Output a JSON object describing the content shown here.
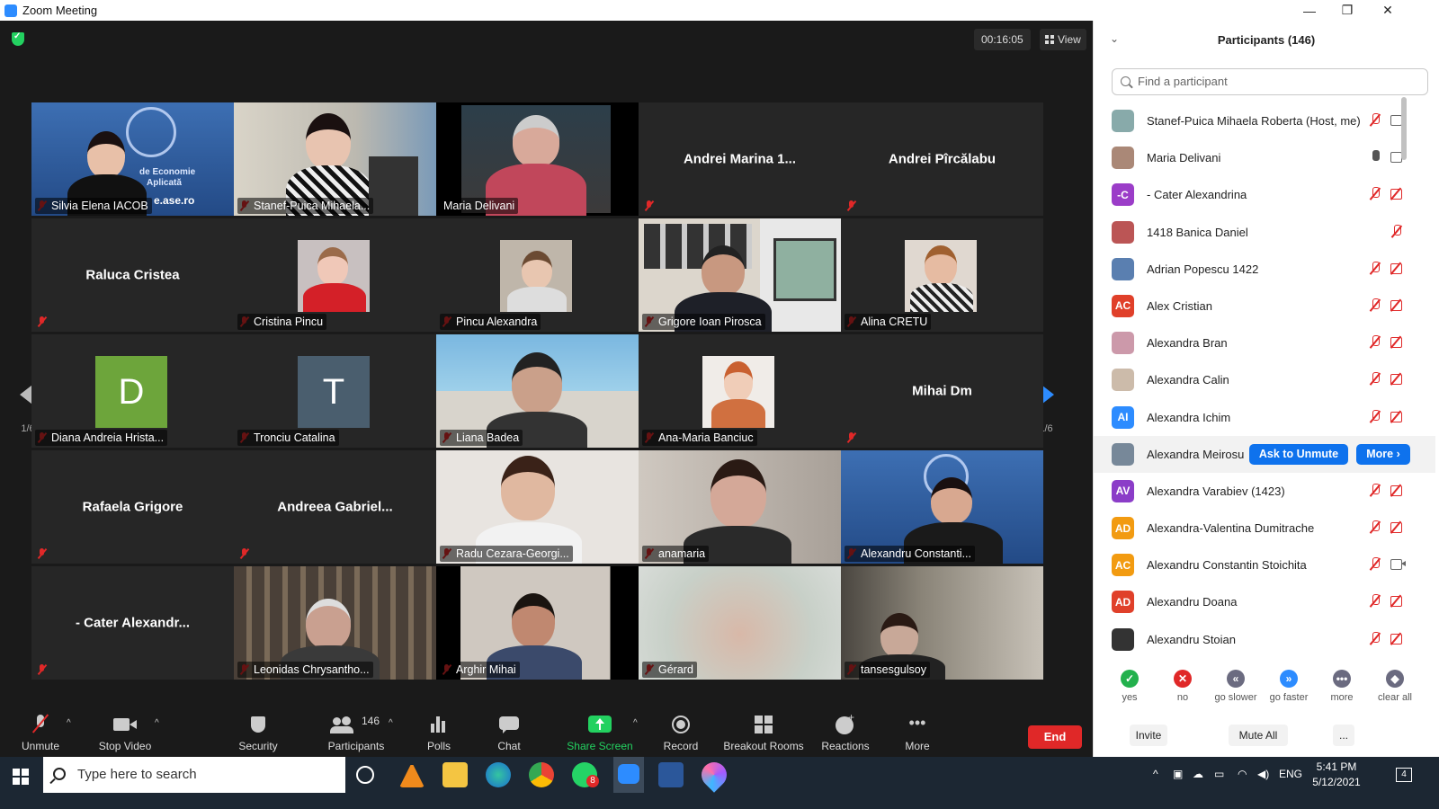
{
  "window": {
    "title": "Zoom Meeting",
    "minimize": "—",
    "maximize": "❐",
    "close": "✕"
  },
  "meeting": {
    "timer": "00:16:05",
    "view_label": "View"
  },
  "pager": {
    "left": "1/6",
    "right": "1/6"
  },
  "tiles": [
    {
      "name": "Silvia Elena IACOB",
      "kind": "video"
    },
    {
      "name": "Stanef-Puica Mihaela...",
      "kind": "video"
    },
    {
      "name": "Maria Delivani",
      "kind": "video",
      "active": true
    },
    {
      "name": "Andrei Marina 1...",
      "kind": "name",
      "label": ""
    },
    {
      "name": "Andrei Pîrcălabu",
      "kind": "name",
      "label": ""
    },
    {
      "name": "Raluca Cristea",
      "kind": "name",
      "label": ""
    },
    {
      "name": "Cristina Pincu",
      "kind": "photo"
    },
    {
      "name": "Pincu Alexandra",
      "kind": "photo"
    },
    {
      "name": "Grigore Ioan Pirosca",
      "kind": "video"
    },
    {
      "name": "Alina CRETU",
      "kind": "photo"
    },
    {
      "name": "Diana Andreia Hrista...",
      "kind": "letter",
      "letter": "D",
      "color": "#6da53b"
    },
    {
      "name": "Tronciu Catalina",
      "kind": "letter",
      "letter": "T",
      "color": "#4a5e6e"
    },
    {
      "name": "Liana Badea",
      "kind": "video"
    },
    {
      "name": "Ana-Maria Banciuc",
      "kind": "photo"
    },
    {
      "name": "Mihai Dm",
      "kind": "name",
      "label": ""
    },
    {
      "name": "Rafaela Grigore",
      "kind": "name",
      "label": ""
    },
    {
      "name": "Andreea Gabriel...",
      "kind": "name",
      "label": ""
    },
    {
      "name": "Radu Cezara-Georgi...",
      "kind": "video"
    },
    {
      "name": "anamaria",
      "kind": "video"
    },
    {
      "name": "Alexandru Constanti...",
      "kind": "video"
    },
    {
      "name": "- Cater Alexandr...",
      "kind": "name",
      "label": ""
    },
    {
      "name": "Leonidas Chrysantho...",
      "kind": "video"
    },
    {
      "name": "Arghir Mihai",
      "kind": "video"
    },
    {
      "name": "Gérard",
      "kind": "video"
    },
    {
      "name": "tansesgulsoy",
      "kind": "video"
    }
  ],
  "tile_overlay": {
    "banner_line1": "de Economie",
    "banner_line2": "Aplicată",
    "banner_url": "e.ase.ro"
  },
  "toolbar": {
    "unmute": "Unmute",
    "stop_video": "Stop Video",
    "security": "Security",
    "participants": "Participants",
    "participants_count": "146",
    "polls": "Polls",
    "chat": "Chat",
    "share_screen": "Share Screen",
    "record": "Record",
    "breakout": "Breakout Rooms",
    "reactions": "Reactions",
    "more": "More",
    "end": "End"
  },
  "panel": {
    "title": "Participants (146)",
    "search_placeholder": "Find a participant",
    "participants": [
      {
        "name": "Stanef-Puica Mihaela Roberta (Host, me)",
        "initials": "",
        "color": "#8aa",
        "mic": "muted",
        "cam": "on"
      },
      {
        "name": "Maria Delivani",
        "initials": "",
        "color": "#a87",
        "mic": "on",
        "cam": "on"
      },
      {
        "name": "- Cater Alexandrina",
        "initials": "-C",
        "color": "#9b3dc8",
        "mic": "muted",
        "cam": "off"
      },
      {
        "name": "1418 Banica Daniel",
        "initials": "",
        "color": "#b55",
        "mic": "muted",
        "cam": "none"
      },
      {
        "name": "Adrian Popescu 1422",
        "initials": "",
        "color": "#5a7fb0",
        "mic": "muted",
        "cam": "off"
      },
      {
        "name": "Alex Cristian",
        "initials": "AC",
        "color": "#e0402a",
        "mic": "muted",
        "cam": "off"
      },
      {
        "name": "Alexandra Bran",
        "initials": "",
        "color": "#c9a",
        "mic": "muted",
        "cam": "off"
      },
      {
        "name": "Alexandra Calin",
        "initials": "",
        "color": "#cba",
        "mic": "muted",
        "cam": "off"
      },
      {
        "name": "Alexandra Ichim",
        "initials": "AI",
        "color": "#2d8cff",
        "mic": "muted",
        "cam": "off"
      },
      {
        "name": "Alexandra Meirosu",
        "initials": "",
        "color": "#789",
        "mic": "",
        "cam": "",
        "hover": true
      },
      {
        "name": "Alexandra Varabiev (1423)",
        "initials": "AV",
        "color": "#8b3dc8",
        "mic": "muted",
        "cam": "off"
      },
      {
        "name": "Alexandra-Valentina Dumitrache",
        "initials": "AD",
        "color": "#f29b11",
        "mic": "muted",
        "cam": "off"
      },
      {
        "name": "Alexandru Constantin Stoichita",
        "initials": "AC",
        "color": "#f29b11",
        "mic": "muted",
        "cam": "on"
      },
      {
        "name": "Alexandru Doana",
        "initials": "AD",
        "color": "#e0402a",
        "mic": "muted",
        "cam": "off"
      },
      {
        "name": "Alexandru Stoian",
        "initials": "",
        "color": "#333",
        "mic": "muted",
        "cam": "off"
      }
    ],
    "ask_to_unmute": "Ask to Unmute",
    "more": "More ›",
    "reactions": [
      {
        "label": "yes",
        "glyph": "✓",
        "color": "#23b14d"
      },
      {
        "label": "no",
        "glyph": "✕",
        "color": "#e02828"
      },
      {
        "label": "go slower",
        "glyph": "«",
        "color": "#6b6b80"
      },
      {
        "label": "go faster",
        "glyph": "»",
        "color": "#2d8cff"
      },
      {
        "label": "more",
        "glyph": "•••",
        "color": "#6b6b80"
      },
      {
        "label": "clear all",
        "glyph": "◆",
        "color": "#6b6b80"
      }
    ],
    "invite": "Invite",
    "mute_all": "Mute All",
    "ellipsis": "..."
  },
  "taskbar": {
    "search_placeholder": "Type here to search",
    "whatsapp_badge": "8",
    "lang": "ENG",
    "time": "5:41 PM",
    "date": "5/12/2021",
    "notif_count": "4"
  }
}
